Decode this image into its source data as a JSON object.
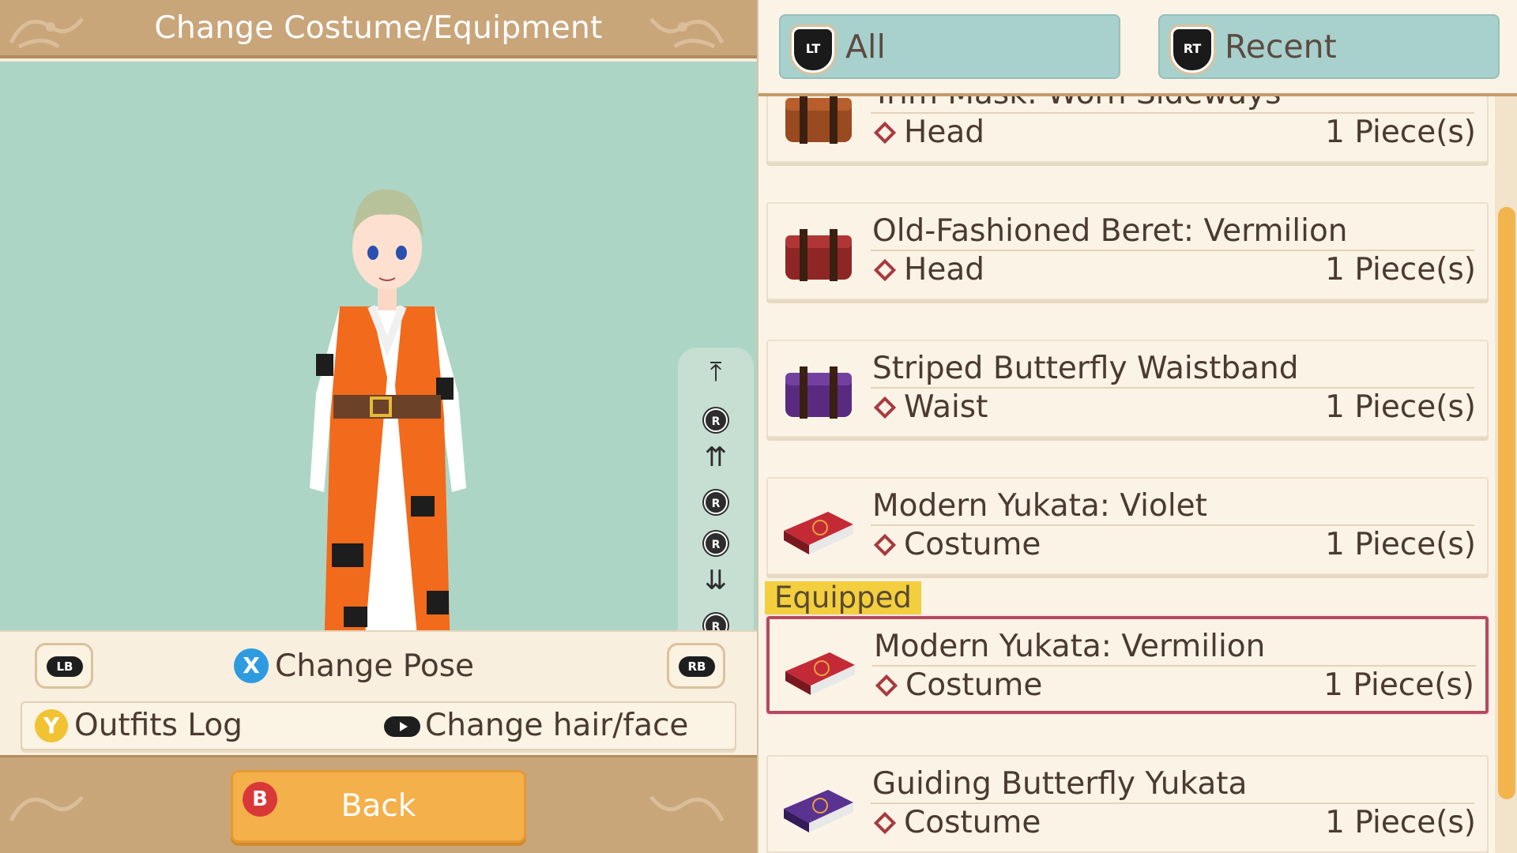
{
  "header": {
    "title": "Change Costume/Equipment"
  },
  "preview": {
    "camera_controls": [
      {
        "icon": "scroll-top-icon"
      },
      {
        "icon": "r-stick-up-icon",
        "button": "R"
      },
      {
        "icon": "double-up-arrow-icon"
      },
      {
        "icon": "r-stick-left-icon",
        "button": "R"
      },
      {
        "icon": "r-stick-right-icon",
        "button": "R"
      },
      {
        "icon": "double-down-arrow-icon"
      },
      {
        "icon": "r-stick-down-icon",
        "button": "R"
      },
      {
        "icon": "scroll-bottom-icon"
      }
    ]
  },
  "controls": {
    "lb": "LB",
    "rb": "RB",
    "x_button": "X",
    "change_pose": "Change Pose",
    "y_button": "Y",
    "outfits_log": "Outfits Log",
    "change_hair_face": "Change hair/face"
  },
  "footer": {
    "b_button": "B",
    "back": "Back"
  },
  "filters": {
    "all": {
      "badge": "LT",
      "label": "All"
    },
    "recent": {
      "badge": "RT",
      "label": "Recent"
    }
  },
  "items": [
    {
      "name": "Trim Mask: Worn Sideways",
      "category": "Head",
      "quantity": "1 Piece(s)",
      "icon": "leather-box-icon",
      "color": "#9a4a20",
      "equipped": false
    },
    {
      "name": "Old-Fashioned Beret: Vermilion",
      "category": "Head",
      "quantity": "1 Piece(s)",
      "icon": "leather-box-icon",
      "color": "#8e2626",
      "equipped": false
    },
    {
      "name": "Striped Butterfly Waistband",
      "category": "Waist",
      "quantity": "1 Piece(s)",
      "icon": "leather-box-icon",
      "color": "#5a2a80",
      "equipped": false
    },
    {
      "name": "Modern Yukata: Violet",
      "category": "Costume",
      "quantity": "1 Piece(s)",
      "icon": "costume-case-icon",
      "color": "#a31c2a",
      "equipped": false
    },
    {
      "name": "Modern Yukata: Vermilion",
      "category": "Costume",
      "quantity": "1 Piece(s)",
      "icon": "costume-case-icon",
      "color": "#a31c2a",
      "equipped": true
    },
    {
      "name": "Guiding Butterfly Yukata",
      "category": "Costume",
      "quantity": "1 Piece(s)",
      "icon": "costume-case-icon",
      "color": "#4a2a78",
      "equipped": false
    }
  ],
  "equipped_label": "Equipped",
  "colors": {
    "title_bar": "#c9a57a",
    "viewport": "#acd5c6",
    "tab": "#a8d0cd",
    "back_button": "#f4b04a",
    "selected_border": "#b44a5c",
    "equipped_tag": "#f3cf3f",
    "scroll_thumb": "#f2b54d"
  }
}
